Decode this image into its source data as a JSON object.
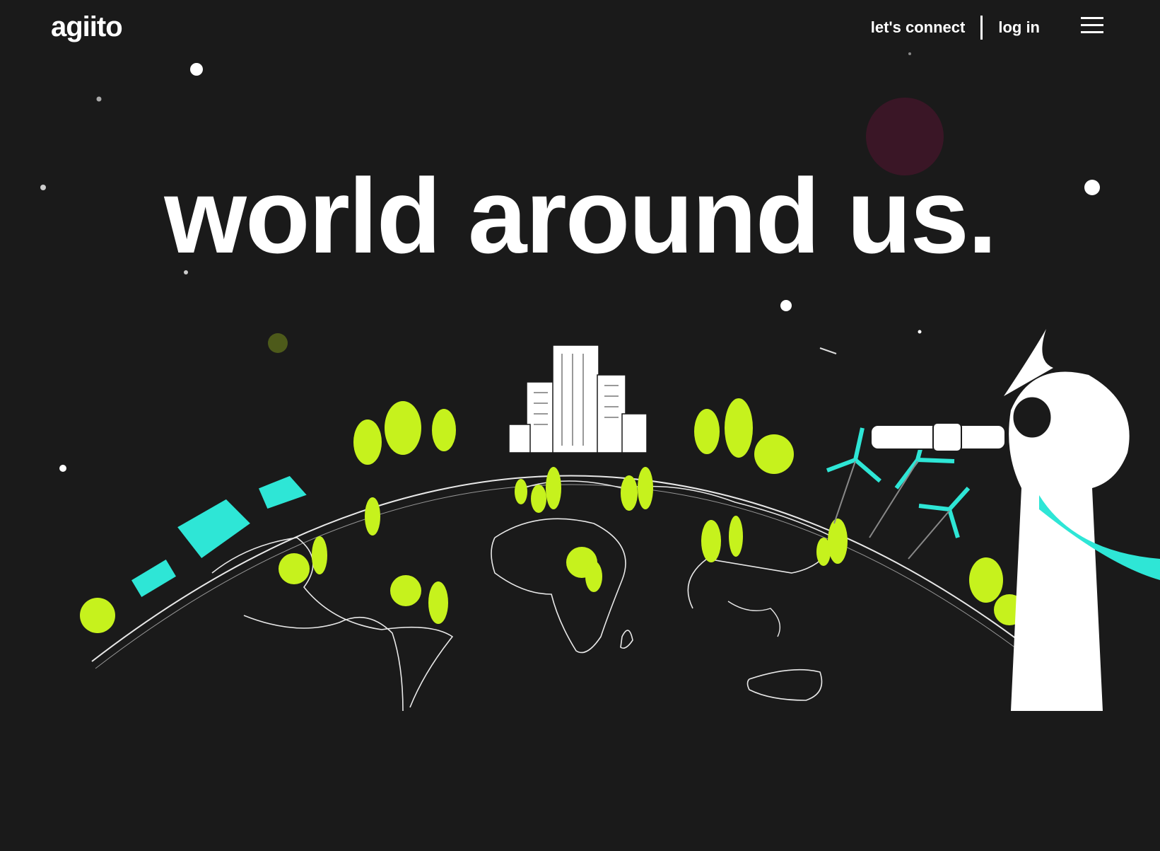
{
  "header": {
    "logo_text": "agiito",
    "connect_label": "let's connect",
    "login_label": "log in",
    "menu_icon": "hamburger-menu-icon"
  },
  "hero": {
    "headline": "world around us."
  },
  "colors": {
    "background": "#1a1a1a",
    "tree_green": "#c6f21d",
    "solar_cyan": "#2ee6d6",
    "text_white": "#ffffff"
  }
}
